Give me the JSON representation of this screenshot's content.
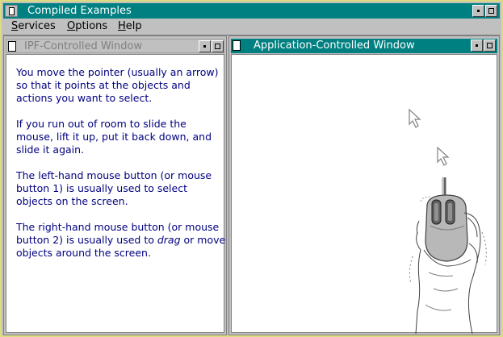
{
  "window": {
    "title": "Compiled Examples",
    "menu": [
      {
        "label": "Services",
        "mnemonic": "S"
      },
      {
        "label": "Options",
        "mnemonic": "O"
      },
      {
        "label": "Help",
        "mnemonic": "H"
      }
    ]
  },
  "ipf_window": {
    "title": "IPF-Controlled Window",
    "paragraphs": [
      "You move the pointer (usually an arrow) so that it points at the objects and actions you want to select.",
      "If you run out of room to slide the mouse, lift it up, put it back down, and slide it again.",
      "The left-hand mouse button (or mouse button 1) is usually used to select objects on the screen."
    ],
    "para4_before": "The right-hand mouse button (or mouse button 2) is usually used to ",
    "para4_emphasis": "drag",
    "para4_after": " or move objects around the screen."
  },
  "app_window": {
    "title": "Application-Controlled Window"
  },
  "colors": {
    "active_title": "#008080",
    "inactive_title": "#c0c0c0",
    "help_text": "#000080",
    "frame": "#dcdc80"
  },
  "icons": [
    "system-menu-icon",
    "minimize-icon",
    "maximize-icon",
    "arrow-pointer-icon",
    "hand-on-mouse-illustration"
  ]
}
